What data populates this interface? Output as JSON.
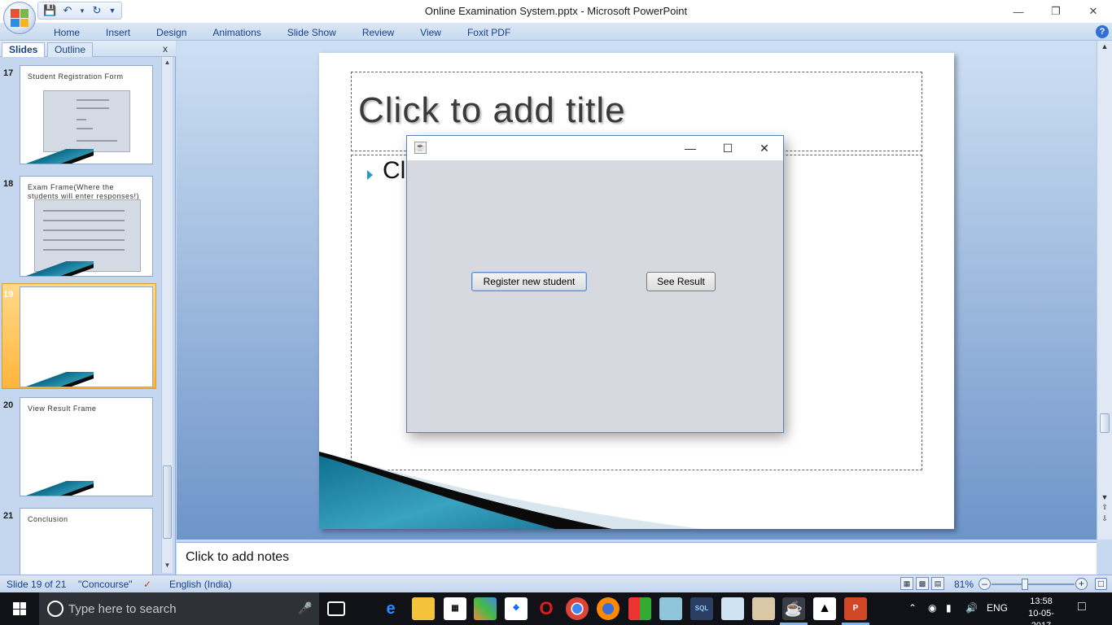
{
  "window": {
    "title": "Online Examination System.pptx - Microsoft PowerPoint",
    "quick_access": [
      "save-icon",
      "undo-icon",
      "redo-icon",
      "customize-icon"
    ],
    "controls": [
      "minimize-icon",
      "restore-icon",
      "close-icon"
    ]
  },
  "ribbon": {
    "tabs": [
      "Home",
      "Insert",
      "Design",
      "Animations",
      "Slide Show",
      "Review",
      "View",
      "Foxit PDF"
    ]
  },
  "slides_panel": {
    "tabs": [
      "Slides",
      "Outline"
    ],
    "close": "x",
    "thumbnails": [
      {
        "number": "17",
        "title": "Student Registration Form"
      },
      {
        "number": "18",
        "title": "Exam Frame(Where the students will enter responses!)"
      },
      {
        "number": "19",
        "title": ""
      },
      {
        "number": "20",
        "title": "View Result Frame"
      },
      {
        "number": "21",
        "title": "Conclusion"
      }
    ],
    "selected": "19"
  },
  "slide": {
    "title_placeholder": "Click to add title",
    "body_placeholder_visible": "Cl"
  },
  "java_dialog": {
    "icon": "java-icon",
    "buttons": {
      "register": "Register new student",
      "result": "See Result"
    }
  },
  "notes": {
    "placeholder": "Click to add notes"
  },
  "status_bar": {
    "slide_info": "Slide 19 of 21",
    "theme": "\"Concourse\"",
    "language": "English (India)",
    "zoom": "81%"
  },
  "taskbar": {
    "search_placeholder": "Type here to search",
    "language": "ENG",
    "time": "13:58",
    "date": "10-05-2017"
  },
  "colors": {
    "accent": "#2a9bbd",
    "selection": "#ffb53c",
    "ribbon_text": "#15428b"
  }
}
